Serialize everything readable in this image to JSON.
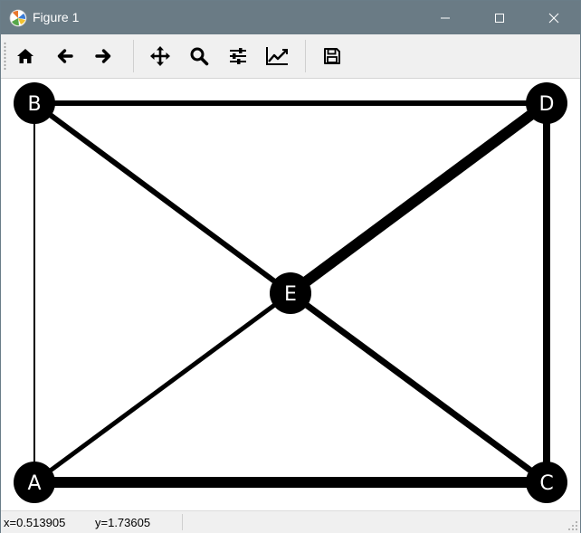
{
  "window": {
    "title": "Figure 1",
    "icon": "matplotlib-logo-icon",
    "controls": [
      "minimize-icon",
      "maximize-icon",
      "close-icon"
    ]
  },
  "toolbar": {
    "buttons": [
      {
        "name": "home-button",
        "icon": "home-icon"
      },
      {
        "name": "back-button",
        "icon": "arrow-left-icon"
      },
      {
        "name": "forward-button",
        "icon": "arrow-right-icon"
      },
      {
        "name": "pan-button",
        "icon": "move-arrows-icon"
      },
      {
        "name": "zoom-button",
        "icon": "magnifier-icon"
      },
      {
        "name": "configure-subplots-button",
        "icon": "sliders-icon"
      },
      {
        "name": "edit-axes-button",
        "icon": "line-chart-icon"
      },
      {
        "name": "save-button",
        "icon": "floppy-disk-icon"
      }
    ]
  },
  "status": {
    "x": "x=0.513905",
    "y": "y=1.73605"
  },
  "graph": {
    "node_color": "#000000",
    "label_color": "#ffffff",
    "edge_color": "#000000",
    "nodes": [
      {
        "id": "A",
        "label": "A"
      },
      {
        "id": "B",
        "label": "B"
      },
      {
        "id": "C",
        "label": "C"
      },
      {
        "id": "D",
        "label": "D"
      },
      {
        "id": "E",
        "label": "E"
      }
    ],
    "edges": [
      {
        "source": "A",
        "target": "B",
        "weight": 1
      },
      {
        "source": "B",
        "target": "D",
        "weight": 3
      },
      {
        "source": "A",
        "target": "C",
        "weight": 6
      },
      {
        "source": "C",
        "target": "D",
        "weight": 4
      },
      {
        "source": "B",
        "target": "E",
        "weight": 3
      },
      {
        "source": "A",
        "target": "E",
        "weight": 2.5
      },
      {
        "source": "E",
        "target": "D",
        "weight": 6
      },
      {
        "source": "E",
        "target": "C",
        "weight": 3.5
      }
    ]
  }
}
